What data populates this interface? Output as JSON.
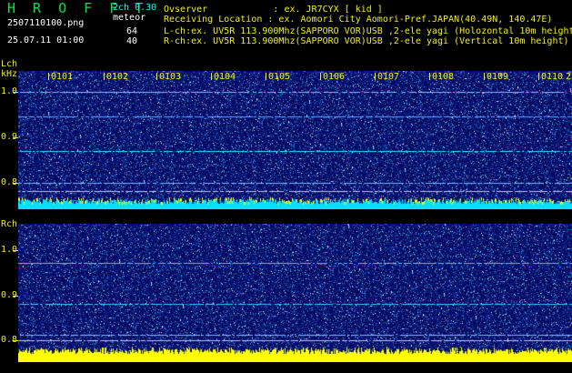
{
  "app": {
    "title": "H R O F F T",
    "version": "2ch 0.30",
    "filename": "2507110100.png",
    "datetime": "25.07.11 01:00"
  },
  "meteor": {
    "label": "meteor",
    "lch_count": "64",
    "rch_count": "40"
  },
  "info": {
    "observer": "Ovserver            : ex. JR7CYX [ kid ]",
    "location": "Receiving Location : ex. Aomori City Aomori-Pref.JAPAN(40.49N, 140.47E)",
    "lch": "L-ch:ex. UV5R 113.900Mhz(SAPPORO VOR)USB ,2-ele yagi (Holozontal 10m height",
    "rch": "R-ch:ex. UV5R 113.900Mhz(SAPPORO VOR)USB ,2-ele yagi (Vertical 10m height)"
  },
  "left_channel": {
    "label_top": "Lch",
    "label_bottom": "kHz",
    "y_ticks": [
      "1.0",
      "0.9",
      "0.8"
    ]
  },
  "right_channel": {
    "label": "Rch",
    "y_ticks": [
      "1.0",
      "0.9",
      "0.8"
    ]
  },
  "time_ticks": [
    "0101",
    "0102",
    "0103",
    "0104",
    "0105",
    "0106",
    "0107",
    "0108",
    "0109",
    "0110",
    "2"
  ],
  "colors": {
    "green_text": "#00e64d",
    "yellow_text": "#f2f200",
    "spectrogram_bg": "#0a0a6e",
    "cyan_strip": "#00ffff",
    "yellow_strip": "#ffff00"
  }
}
